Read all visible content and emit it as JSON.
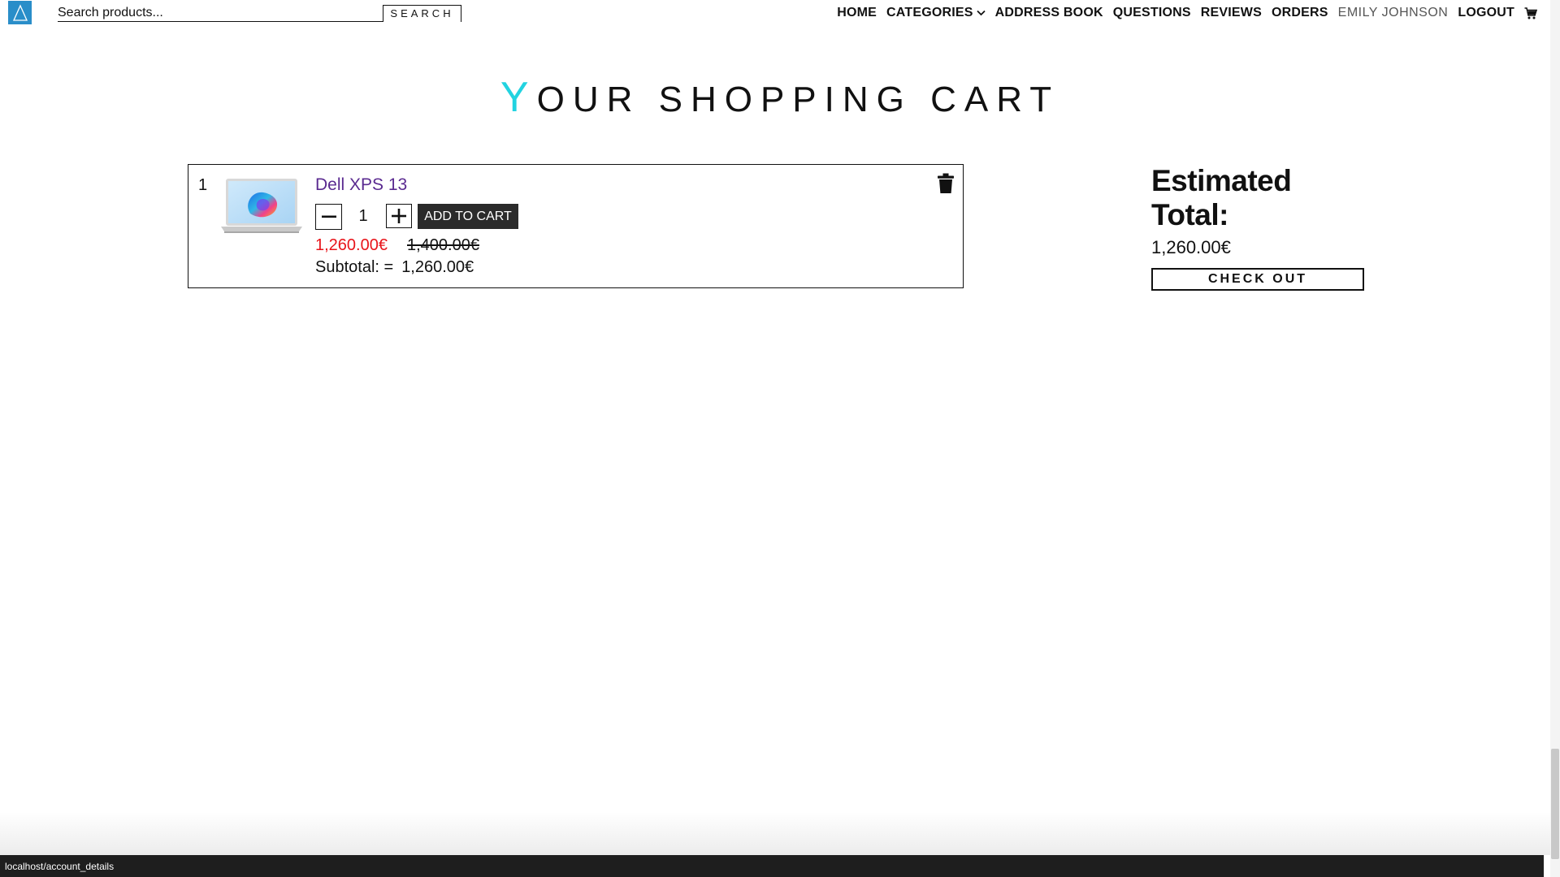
{
  "header": {
    "search": {
      "placeholder": "Search products...",
      "value": "",
      "button_label": "SEARCH"
    },
    "nav": {
      "home": "HOME",
      "categories": "CATEGORIES",
      "address_book": "ADDRESS BOOK",
      "questions": "QUESTIONS",
      "reviews": "REVIEWS",
      "orders": "ORDERS",
      "user": "EMILY JOHNSON",
      "logout": "LOGOUT"
    }
  },
  "page": {
    "title_first": "Y",
    "title_rest": "OUR SHOPPING CART"
  },
  "cart": {
    "items": [
      {
        "index": "1",
        "name": "Dell XPS 13",
        "quantity": "1",
        "add_label": "ADD TO CART",
        "price_sale": "1,260.00€",
        "price_original": "1,400.00€",
        "subtotal_label": "Subtotal: =",
        "subtotal_value": "1,260.00€"
      }
    ]
  },
  "summary": {
    "title": "Estimated Total:",
    "total": "1,260.00€",
    "checkout_label": "CHECK OUT"
  },
  "status_bar": {
    "url": "localhost/account_details"
  },
  "colors": {
    "accent_cyan": "#22d3e0",
    "logo_blue": "#2a8ec9",
    "sale_red": "#e8141a",
    "product_link": "#5a2a90"
  },
  "icons": [
    "logo-icon",
    "chevron-down-icon",
    "cart-icon",
    "minus-icon",
    "plus-icon",
    "trash-icon"
  ]
}
